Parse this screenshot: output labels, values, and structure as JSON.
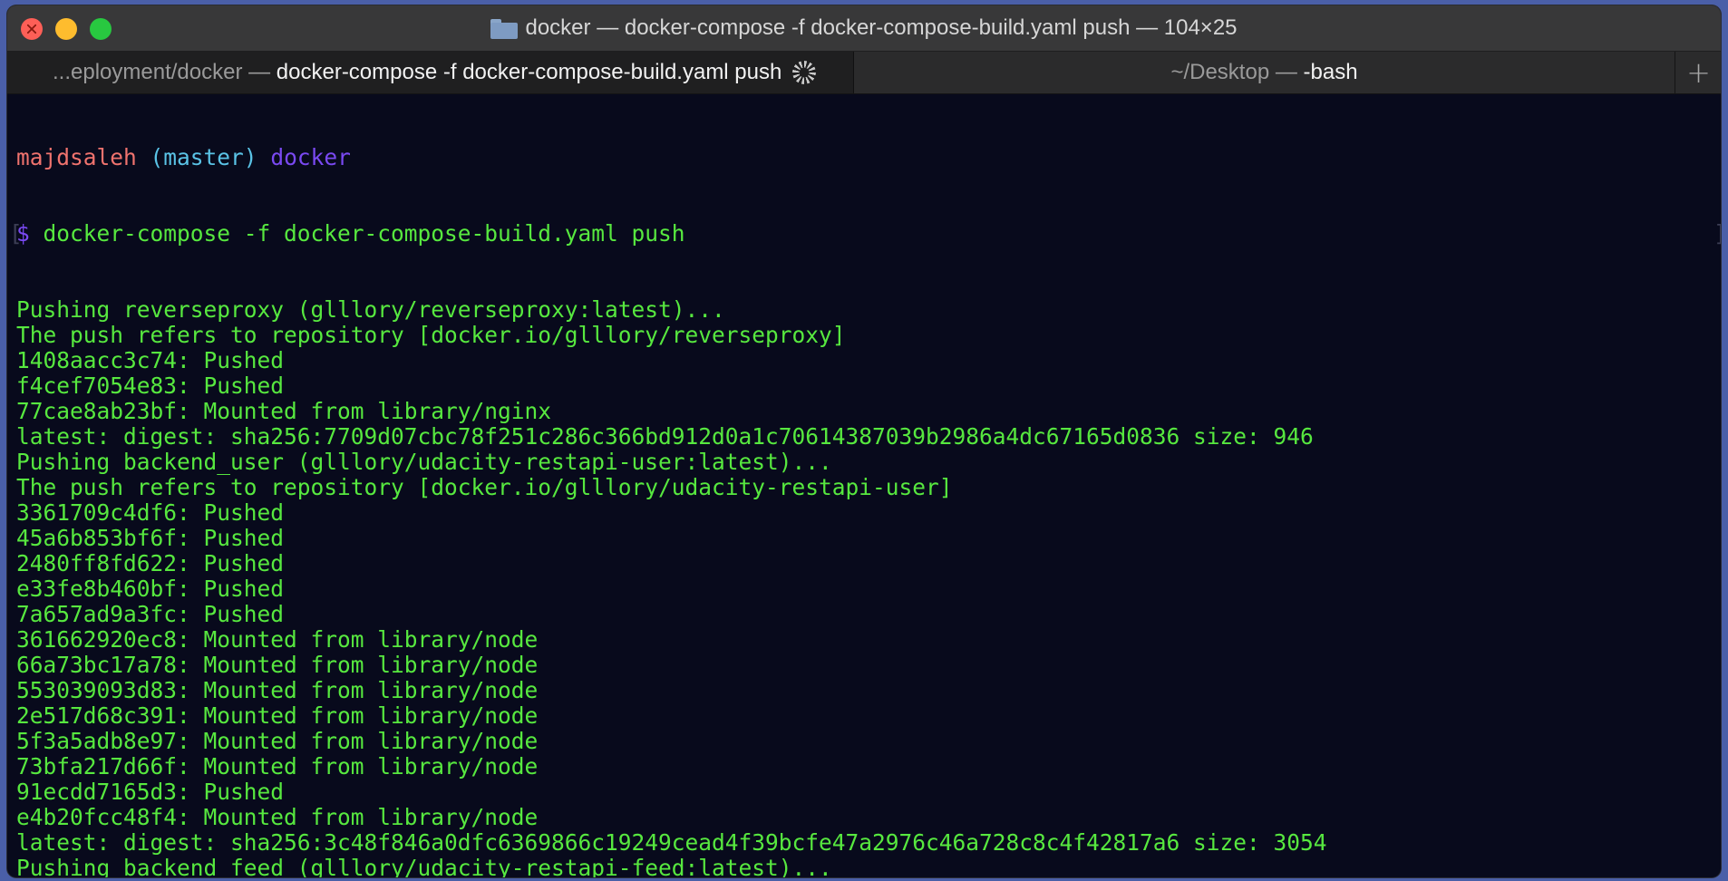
{
  "window": {
    "title": "docker — docker-compose -f docker-compose-build.yaml push — 104×25"
  },
  "tabs": [
    {
      "path_label": "...eployment/docker —",
      "command_label": "docker-compose -f docker-compose-build.yaml push"
    },
    {
      "path_label": "~/Desktop —",
      "command_label": "-bash"
    }
  ],
  "new_tab_label": "+",
  "prompt": {
    "user": "majdsaleh",
    "branch": "(master)",
    "dir": "docker",
    "symbol": "$",
    "command": " docker-compose -f docker-compose-build.yaml push"
  },
  "output_lines": [
    "Pushing reverseproxy (glllory/reverseproxy:latest)...",
    "The push refers to repository [docker.io/glllory/reverseproxy]",
    "1408aacc3c74: Pushed",
    "f4cef7054e83: Pushed",
    "77cae8ab23bf: Mounted from library/nginx",
    "latest: digest: sha256:7709d07cbc78f251c286c366bd912d0a1c70614387039b2986a4dc67165d0836 size: 946",
    "Pushing backend_user (glllory/udacity-restapi-user:latest)...",
    "The push refers to repository [docker.io/glllory/udacity-restapi-user]",
    "3361709c4df6: Pushed",
    "45a6b853bf6f: Pushed",
    "2480ff8fd622: Pushed",
    "e33fe8b460bf: Pushed",
    "7a657ad9a3fc: Pushed",
    "361662920ec8: Mounted from library/node",
    "66a73bc17a78: Mounted from library/node",
    "553039093d83: Mounted from library/node",
    "2e517d68c391: Mounted from library/node",
    "5f3a5adb8e97: Mounted from library/node",
    "73bfa217d66f: Mounted from library/node",
    "91ecdd7165d3: Pushed",
    "e4b20fcc48f4: Mounted from library/node",
    "latest: digest: sha256:3c48f846a0dfc6369866c19249cead4f39bcfe47a2976c46a728c8c4f42817a6 size: 3054",
    "Pushing backend_feed (glllory/udacity-restapi-feed:latest)..."
  ],
  "colors": {
    "output_green": "#57e83f",
    "user_red": "#f0736e",
    "branch_cyan": "#5ac3e6",
    "dir_purple": "#7a49f2",
    "background": "#080a1c"
  },
  "icons": {
    "title_folder": "folder-icon",
    "tab1_activity": "spinner-icon"
  }
}
